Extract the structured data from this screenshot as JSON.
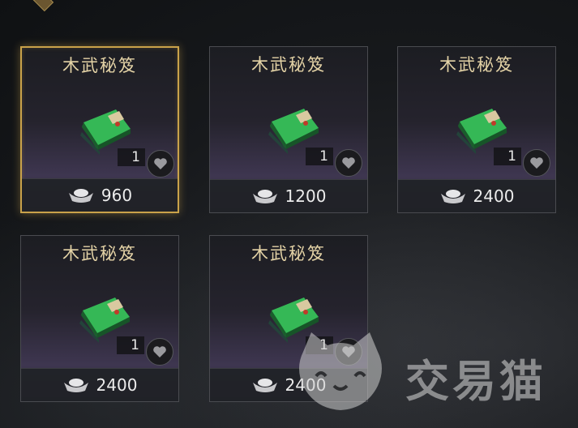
{
  "items": [
    {
      "name": "木武秘笈",
      "quantity": "1",
      "price": "960",
      "selected": true
    },
    {
      "name": "木武秘笈",
      "quantity": "1",
      "price": "1200",
      "selected": false
    },
    {
      "name": "木武秘笈",
      "quantity": "1",
      "price": "2400",
      "selected": false
    },
    {
      "name": "木武秘笈",
      "quantity": "1",
      "price": "2400",
      "selected": false
    },
    {
      "name": "木武秘笈",
      "quantity": "1",
      "price": "2400",
      "selected": false
    }
  ],
  "icons": {
    "item": "green-book-icon",
    "currency": "silver-ingot-icon",
    "favorite": "heart-icon"
  },
  "watermark": {
    "text": "交易猫"
  },
  "colors": {
    "selected_border": "#c9a24a",
    "title_text": "#e4d3a6",
    "book_green": "#2f9a48"
  }
}
